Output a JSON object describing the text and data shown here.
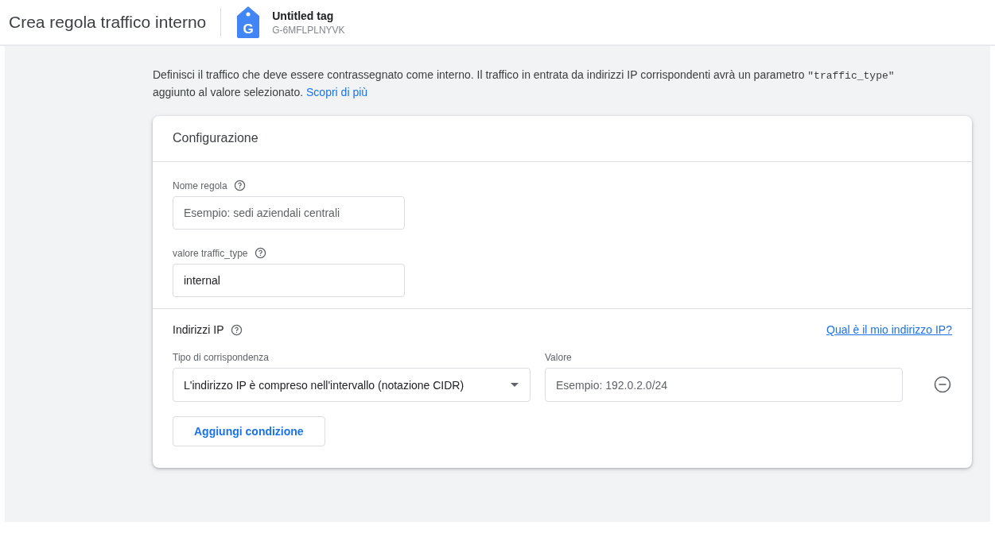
{
  "header": {
    "title": "Crea regola traffico interno",
    "tag": {
      "name": "Untitled tag",
      "id": "G-6MFLPLNYVK",
      "icon_letter": "G"
    }
  },
  "intro": {
    "text_before": "Definisci il traffico che deve essere contrassegnato come interno. Il traffico in entrata da indirizzi IP corrispondenti avrà un parametro ",
    "code": "\"traffic_type\"",
    "text_after": " aggiunto al valore selezionato. ",
    "link": "Scopri di più"
  },
  "card": {
    "title": "Configurazione",
    "fields": [
      {
        "label": "Nome regola",
        "placeholder": "Esempio: sedi aziendali centrali"
      },
      {
        "label": "valore traffic_type",
        "value": "internal"
      }
    ],
    "ip_section": {
      "title": "Indirizzi IP",
      "link": "Qual è il mio indirizzo IP?",
      "conditions": [
        {
          "match_label": "Tipo di corrispondenza",
          "match_value": "L'indirizzo IP è compreso nell'intervallo (notazione CIDR)",
          "value_label": "Valore",
          "value_placeholder": "Esempio: 192.0.2.0/24"
        }
      ],
      "add_button": "Aggiungi condizione"
    }
  }
}
